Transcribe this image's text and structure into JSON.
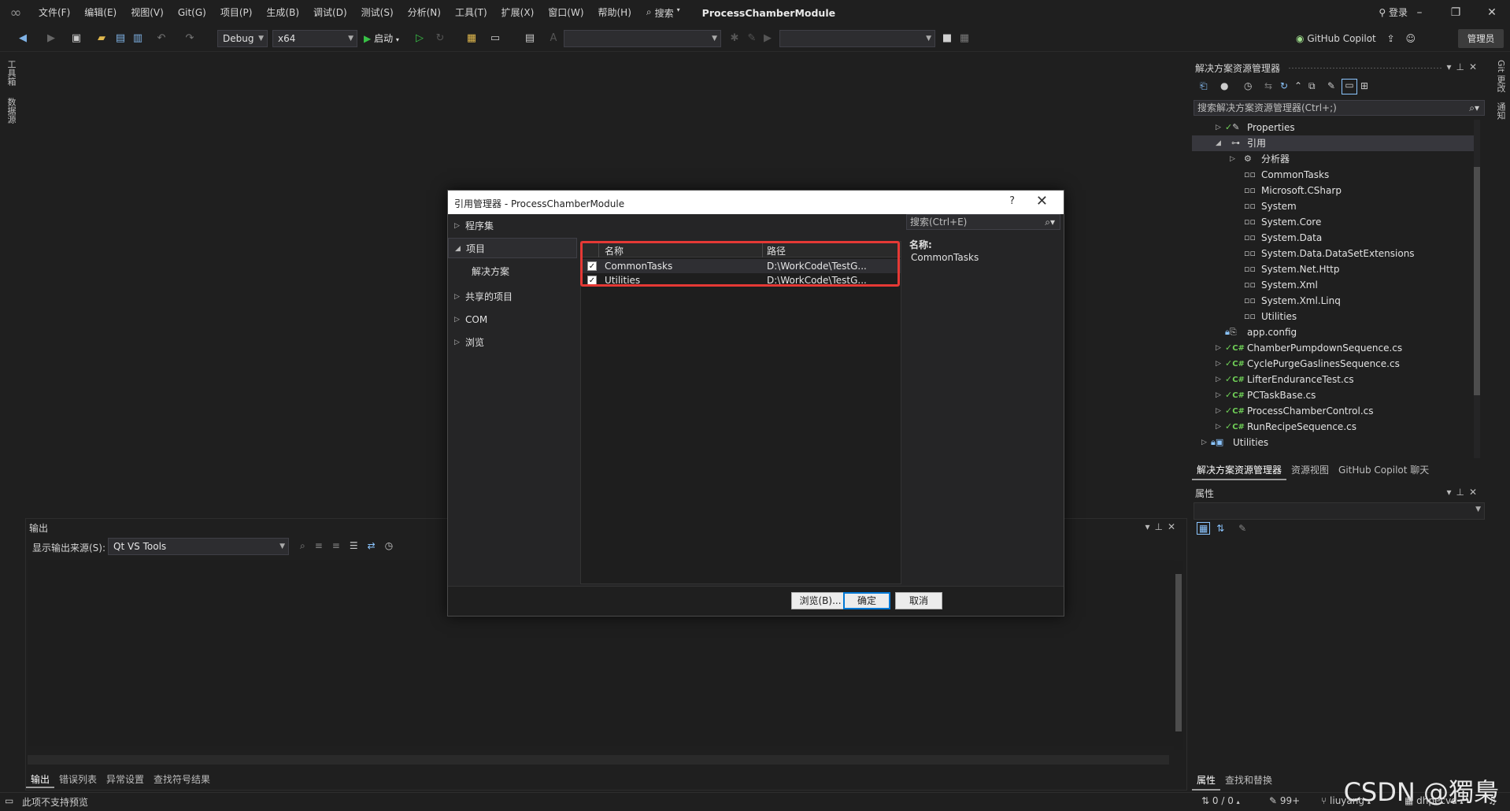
{
  "menubar": {
    "items": [
      "文件(F)",
      "编辑(E)",
      "视图(V)",
      "Git(G)",
      "项目(P)",
      "生成(B)",
      "调试(D)",
      "测试(S)",
      "分析(N)",
      "工具(T)",
      "扩展(X)",
      "窗口(W)",
      "帮助(H)"
    ],
    "search_label": "搜索",
    "solution_name": "ProcessChamberModule",
    "login_label": "登录"
  },
  "toolbar": {
    "config": "Debug",
    "platform": "x64",
    "start_label": "启动",
    "copilot_label": "GitHub Copilot",
    "admin_label": "管理员"
  },
  "left_strip": {
    "tabs": [
      "工具箱",
      "数据源"
    ]
  },
  "right_strip": {
    "tabs": [
      "Git 更改",
      "通知"
    ]
  },
  "output_panel": {
    "title": "输出",
    "source_label": "显示输出来源(S):",
    "source_value": "Qt VS Tools",
    "tabs": [
      "输出",
      "错误列表",
      "异常设置",
      "查找符号结果"
    ]
  },
  "solution_explorer": {
    "title": "解决方案资源管理器",
    "search_placeholder": "搜索解决方案资源管理器(Ctrl+;)",
    "tree": [
      {
        "label": "Properties"
      },
      {
        "label": "引用"
      },
      {
        "label": "分析器"
      },
      {
        "label": "CommonTasks"
      },
      {
        "label": "Microsoft.CSharp"
      },
      {
        "label": "System"
      },
      {
        "label": "System.Core"
      },
      {
        "label": "System.Data"
      },
      {
        "label": "System.Data.DataSetExtensions"
      },
      {
        "label": "System.Net.Http"
      },
      {
        "label": "System.Xml"
      },
      {
        "label": "System.Xml.Linq"
      },
      {
        "label": "Utilities"
      },
      {
        "label": "app.config"
      },
      {
        "label": "ChamberPumpdownSequence.cs"
      },
      {
        "label": "CyclePurgeGaslinesSequence.cs"
      },
      {
        "label": "LifterEnduranceTest.cs"
      },
      {
        "label": "PCTaskBase.cs"
      },
      {
        "label": "ProcessChamberControl.cs"
      },
      {
        "label": "RunRecipeSequence.cs"
      },
      {
        "label": "Utilities"
      }
    ],
    "tabs": [
      "解决方案资源管理器",
      "资源视图",
      "GitHub Copilot 聊天"
    ]
  },
  "properties_panel": {
    "title": "属性",
    "tabs": [
      "属性",
      "查找和替换"
    ]
  },
  "statusbar": {
    "message": "此项不支持预览",
    "lines": "0 / 0",
    "edits": "99+",
    "branch": "liuyang",
    "repo": "dhpecvd",
    "watermark": "CSDN @獨梟"
  },
  "dialog": {
    "title": "引用管理器 - ProcessChamberModule",
    "help_label": "?",
    "nav": [
      {
        "label": "程序集"
      },
      {
        "label": "项目"
      },
      {
        "label": "解决方案"
      },
      {
        "label": "共享的项目"
      },
      {
        "label": "COM"
      },
      {
        "label": "浏览"
      }
    ],
    "columns": {
      "name": "名称",
      "path": "路径"
    },
    "rows": [
      {
        "checked": true,
        "name": "CommonTasks",
        "path": "D:\\WorkCode\\TestG..."
      },
      {
        "checked": true,
        "name": "Utilities",
        "path": "D:\\WorkCode\\TestG..."
      }
    ],
    "search_placeholder": "搜索(Ctrl+E)",
    "detail": {
      "label": "名称:",
      "value": "CommonTasks"
    },
    "buttons": {
      "browse": "浏览(B)...",
      "ok": "确定",
      "cancel": "取消"
    }
  },
  "colors": {
    "accent": "#0078d4",
    "highlight_box": "#e53935",
    "csharp_green": "#6fcf57"
  }
}
